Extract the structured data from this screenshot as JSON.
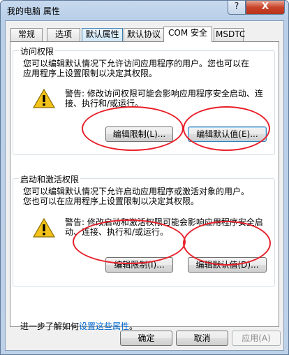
{
  "window": {
    "title": "我的电脑 属性",
    "help_glyph": "?",
    "close_glyph": "X"
  },
  "tabs": [
    {
      "label": "常规"
    },
    {
      "label": "选项"
    },
    {
      "label": "默认属性"
    },
    {
      "label": "默认协议"
    },
    {
      "label": "COM 安全"
    },
    {
      "label": "MSDTC"
    }
  ],
  "active_tab": "COM 安全",
  "access": {
    "title": "访问权限",
    "description": "您可以编辑默认情况下允许访问应用程序的用户。您也可以在应用程序上设置限制以决定其权限。",
    "warning": "警告: 修改访问权限可能会影响应用程序安全启动、连接、执行和/或运行。",
    "edit_limits_label": "编辑限制(L)...",
    "edit_default_label": "编辑默认值(E)..."
  },
  "launch": {
    "title": "启动和激活权限",
    "description": "您可以编辑默认情况下允许启动应用程序或激活对象的用户。您也可以在应用程序上设置限制以决定其权限。",
    "warning": "警告: 修改启动和激活权限可能会影响应用程序安全启动、连接、执行和/或运行。",
    "edit_limits_label": "编辑限制(I)...",
    "edit_default_label": "编辑默认值(D)..."
  },
  "learn_more": {
    "prefix": "进一步了解如何",
    "link": "设置这些属性",
    "suffix": "。"
  },
  "footer": {
    "ok_label": "确定",
    "cancel_label": "取消",
    "apply_label": "应用(A)"
  },
  "colors": {
    "annotation_red": "#e8202a",
    "link_blue": "#0066cc",
    "warning_yellow": "#f2c21a"
  }
}
